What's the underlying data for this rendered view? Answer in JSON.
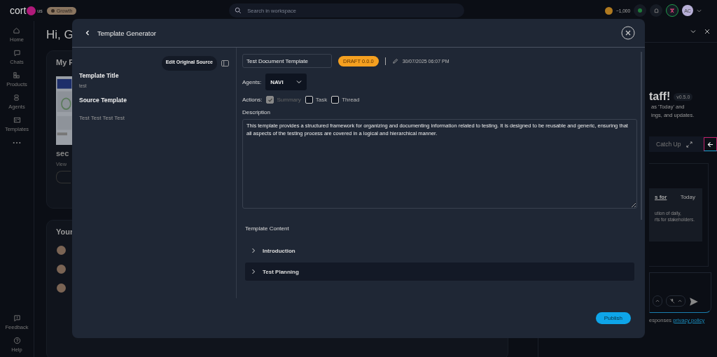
{
  "top_bar": {
    "logo_text": "cort",
    "logo_suffix": "us",
    "plan_badge": "Growth",
    "search": {
      "placeholder": "Search in workspace"
    },
    "credits": "~1,000",
    "avatar_initials": "AC"
  },
  "nav": [
    {
      "label": "Home",
      "kind": "home"
    },
    {
      "label": "Chats",
      "kind": "chat"
    },
    {
      "label": "Products",
      "kind": "products"
    },
    {
      "label": "Agents",
      "kind": "agents"
    },
    {
      "label": "Templates",
      "kind": "templates"
    }
  ],
  "nav_bottom": [
    {
      "label": "Feedback",
      "kind": "feedback"
    },
    {
      "label": "Help",
      "kind": "help"
    }
  ],
  "background_page": {
    "greeting": "Hi, G",
    "recent_card": {
      "title": "My F",
      "item_title": "sec",
      "item_meta": "View"
    },
    "list_card": {
      "title": "Your"
    }
  },
  "assistant_panel": {
    "heading": "taff!",
    "version": "v0.5.0",
    "intro_lines": [
      "as 'Today' and",
      "ings, and updates."
    ],
    "tab": "Catch Up",
    "card": {
      "title": "s for",
      "date": "Today",
      "lines": [
        "ution of daily,",
        "rts for stakeholders."
      ]
    },
    "footer_text": "esponses",
    "footer_link": "privacy policy"
  },
  "modal": {
    "title": "Template Generator",
    "edit_source_button": "Edit Original Source",
    "template_title_label": "Template Title",
    "template_title_value": "test",
    "source_template_label": "Source Template",
    "source_template_value": "Test Test Test Test",
    "document_name": "Test Document Template",
    "status_badge": "DRAFT 0.0.0",
    "updated": "30/07/2025 06:07 PM",
    "agents_label": "Agents:",
    "agent": "NAVI",
    "actions_label": "Actions:",
    "actions": [
      {
        "label": "Summary",
        "checked": true,
        "disabled": true
      },
      {
        "label": "Task",
        "checked": false,
        "disabled": false
      },
      {
        "label": "Thread",
        "checked": false,
        "disabled": false
      }
    ],
    "description_label": "Description",
    "description": "This template provides a structured framework for organizing and documenting information related to testing. It is designed to be reusable and generic, ensuring that all aspects of the testing process are covered in a logical and hierarchical manner.",
    "content_label": "Template Content",
    "sections": [
      {
        "title": "Introduction",
        "selected": false
      },
      {
        "title": "Test Planning",
        "selected": true
      }
    ],
    "publish_button": "Publish"
  }
}
